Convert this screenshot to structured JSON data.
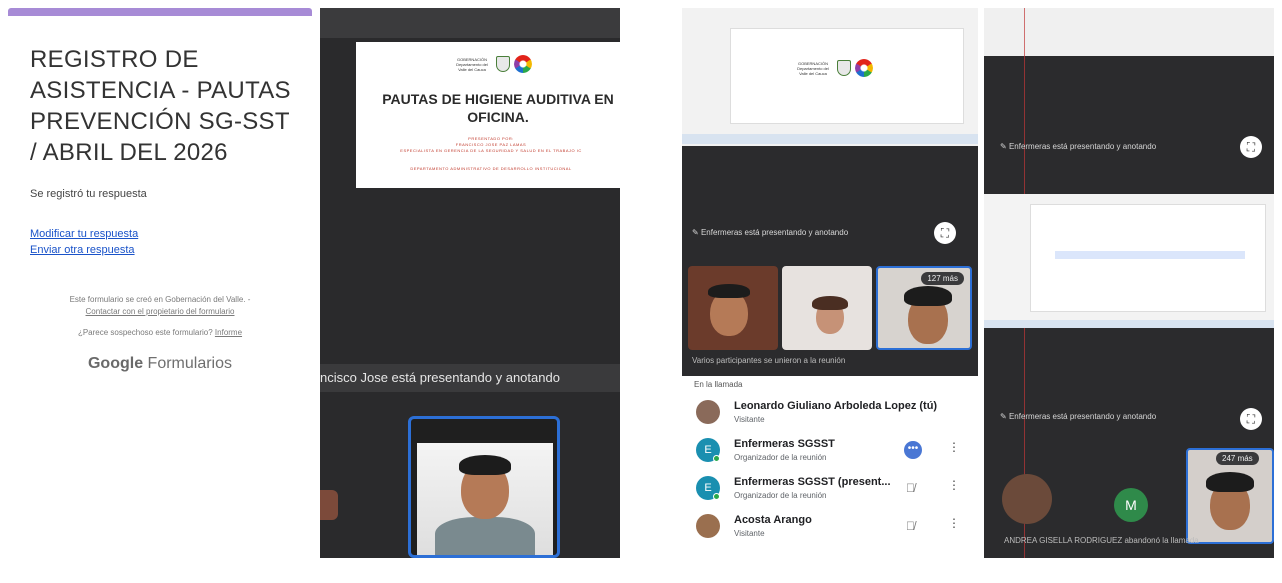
{
  "forms": {
    "title": "REGISTRO DE ASISTENCIA - PAUTAS PREVENCIÓN SG-SST / ABRIL DEL 2026",
    "recorded": "Se registró tu respuesta",
    "edit_link": "Modificar tu respuesta",
    "another_link": "Enviar otra respuesta",
    "footer_created": "Este formulario se creó en Gobernación del Valle. -",
    "footer_contact": "Contactar con el propietario del formulario",
    "suspicious": "¿Parece sospechoso este formulario?",
    "report": "Informe",
    "brand_google": "Google",
    "brand_forms": "Formularios",
    "accent_color": "#a78bd6"
  },
  "meet1": {
    "slide_gov": "GOBERNACIÓN Departamento del Valle del Cauca",
    "slide_title_line1": "PAUTAS DE HIGIENE AUDITIVA EN",
    "slide_title_line2": "OFICINA.",
    "presented_by": "PRESENTADO POR:",
    "presenter_name": "FRANCISCO JOSE PAZ LAMAS",
    "presenter_spec": "ESPECIALISTA EN GERENCIA DE LA SEGURIDAD Y SALUD EN EL TRABAJO IC",
    "department": "DEPARTAMENTO ADMINISTRATIVO DE DESARROLLO INSTITUCIONAL",
    "presenting_label": "ncisco Jose está presentando y anotando"
  },
  "meet2": {
    "presenting_label": "Enfermeras está presentando y anotando",
    "more_count": "127 más",
    "joined": "Varios participantes se unieron a la reunión"
  },
  "participants": {
    "header": "En la llamada",
    "rows": [
      {
        "name": "Leonardo Giuliano Arboleda Lopez (tú)",
        "role": "Visitante",
        "initial": "",
        "color": "#8a6a5a"
      },
      {
        "name": "Enfermeras SGSST",
        "role": "Organizador de la reunión",
        "initial": "E",
        "color": "#1a8fb0"
      },
      {
        "name": "Enfermeras SGSST (present...",
        "role": "Organizador de la reunión",
        "initial": "E",
        "color": "#1a8fb0"
      },
      {
        "name": "Acosta Arango",
        "role": "Visitante",
        "initial": "",
        "color": "#9a6f4f"
      }
    ]
  },
  "meet3": {
    "presenting_top": "Enfermeras está presentando y anotando",
    "presenting_bottom": "Enfermeras está presentando y anotando",
    "more_count": "247 más",
    "m_initial": "M",
    "left_call": "ANDREA GISELLA RODRIGUEZ abandonó la llamada"
  }
}
